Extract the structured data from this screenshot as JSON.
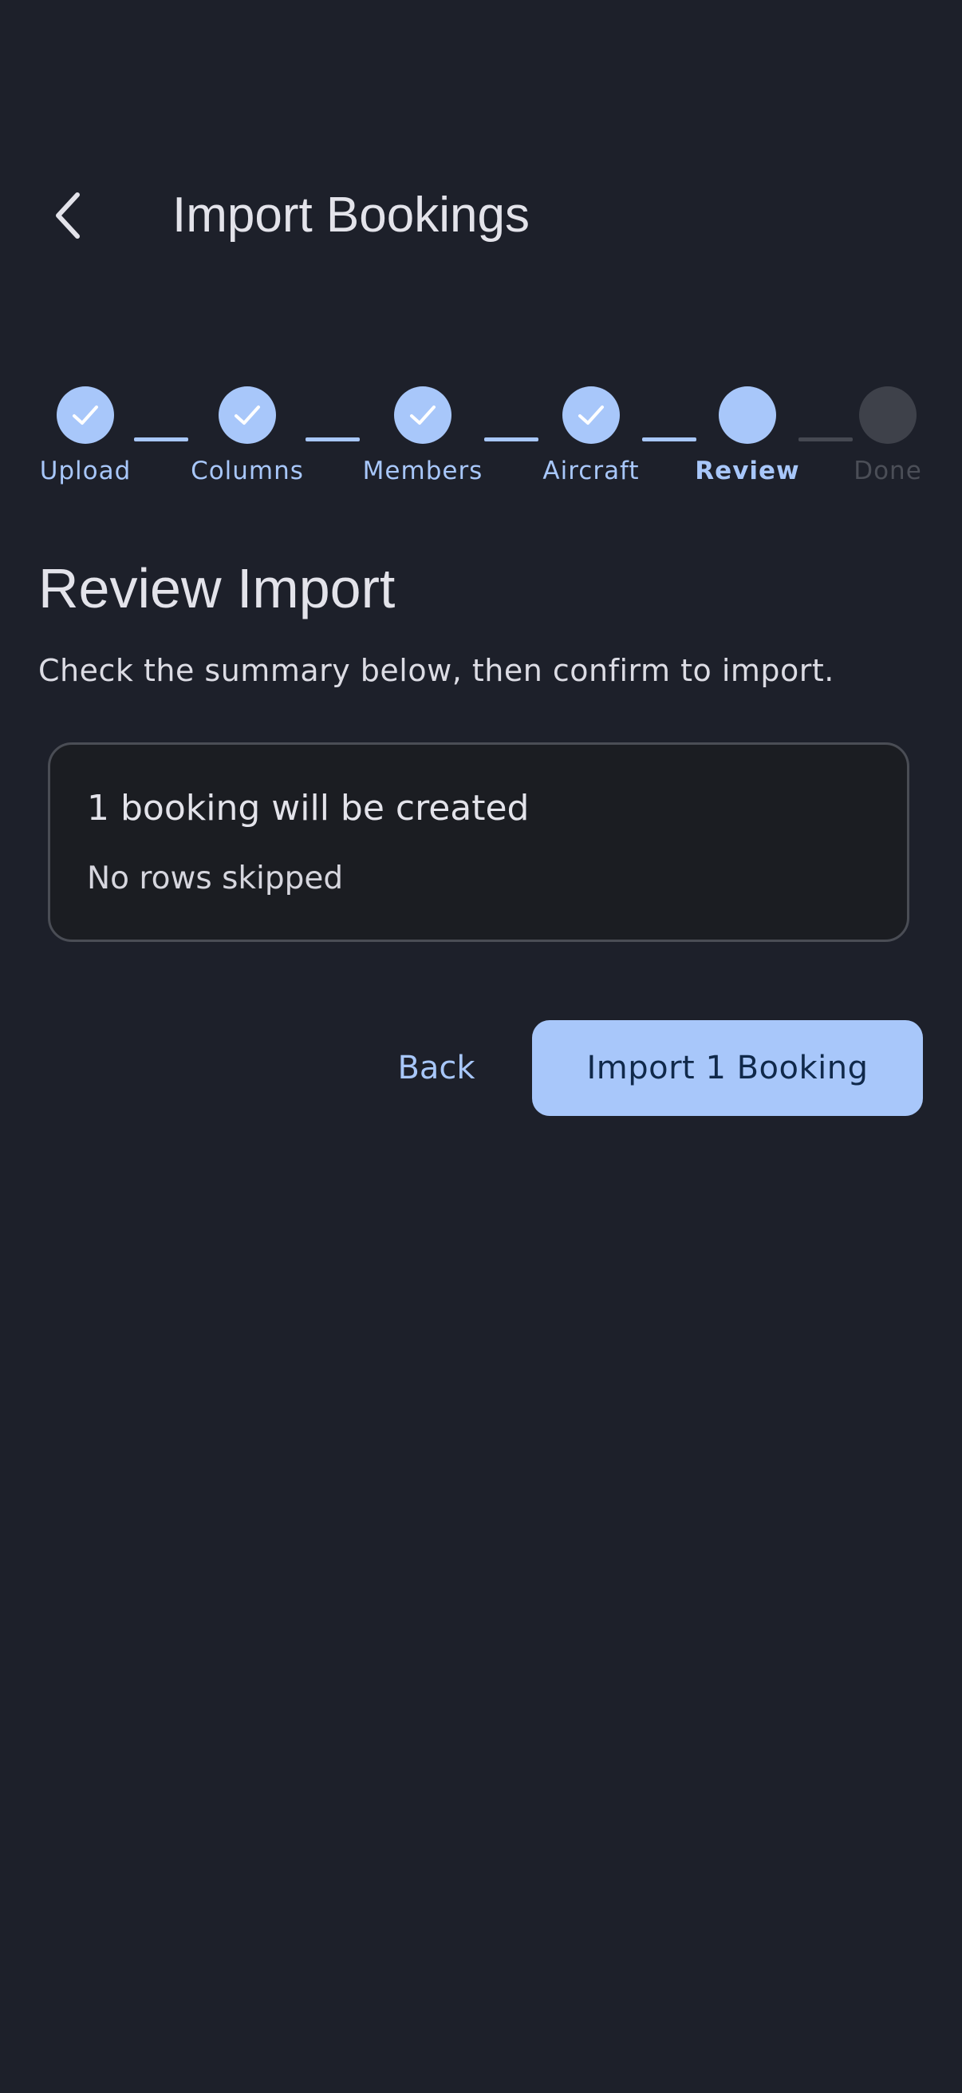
{
  "header": {
    "title": "Import Bookings",
    "back_icon": "chevron-left-icon"
  },
  "stepper": {
    "steps": [
      {
        "label": "Upload",
        "state": "done"
      },
      {
        "label": "Columns",
        "state": "done"
      },
      {
        "label": "Members",
        "state": "done"
      },
      {
        "label": "Aircraft",
        "state": "done"
      },
      {
        "label": "Review",
        "state": "active"
      },
      {
        "label": "Done",
        "state": "pending"
      }
    ],
    "current_step": 5,
    "total_steps": 6
  },
  "main": {
    "title": "Review Import",
    "subtitle": "Check the summary below, then confirm to import."
  },
  "summary": {
    "primary": "1 booking will be created",
    "secondary": "No rows skipped"
  },
  "actions": {
    "back_label": "Back",
    "import_label": "Import 1 Booking"
  },
  "colors": {
    "background": "#1d202a",
    "accent": "#a8c7fa",
    "pending": "#3e414a",
    "on_accent": "#10294a"
  }
}
